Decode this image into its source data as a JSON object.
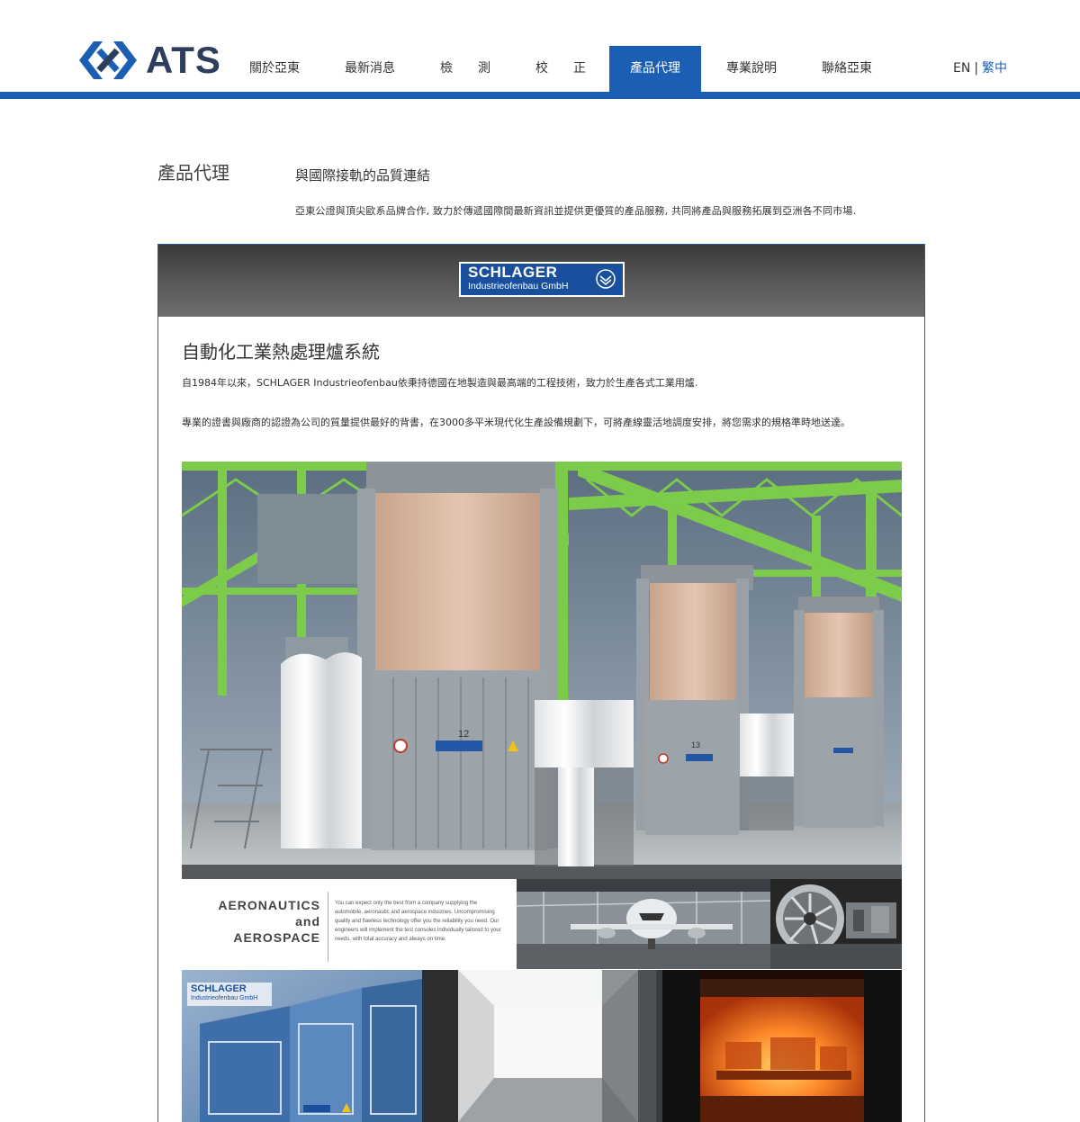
{
  "header": {
    "logo_text": "ATS",
    "nav": [
      {
        "label": "關於亞東"
      },
      {
        "label": "最新消息"
      },
      {
        "label": "檢　　測"
      },
      {
        "label": "校　　正"
      },
      {
        "label": "產品代理"
      },
      {
        "label": "專業說明"
      },
      {
        "label": "聯絡亞東"
      }
    ],
    "lang_en": "EN",
    "lang_sep": "|",
    "lang_current": "繁中"
  },
  "intro": {
    "page_title": "產品代理",
    "subtitle": "與國際接軌的品質連結",
    "text": "亞東公證與頂尖歐系品牌合作, 致力於傳遞國際間最新資訊並提供更優質的產品服務, 共同將產品與服務拓展到亞洲各不同市場."
  },
  "card": {
    "brand_name": "SCHLAGER",
    "brand_sub": "Industrieofenbau GmbH",
    "title": "自動化工業熱處理爐系統",
    "p1": "自1984年以來，SCHLAGER Industrieofenbau依秉持德國在地製造與最高端的工程技術，致力於生產各式工業用爐.",
    "p2": "專業的證書與廠商的認證為公司的質量提供最好的背書，在3000多平米現代化生產設備規劃下，可將產線靈活地調度安排，將您需求的規格準時地送達。"
  },
  "collage": {
    "aero_line1": "AERONAUTICS",
    "aero_line2": "and",
    "aero_line3": "AEROSPACE",
    "aero_body": "You can expect only the best from a company supplying the automobile, aeronautic and aerospace industries. Uncompromising quality and flawless technology offer you the reliability you need. Our engineers will implement the test consoles individually tailored to your needs, with total accuracy and always on time.",
    "mini_brand": "SCHLAGER",
    "mini_sub": "Industrieofenbau GmbH",
    "furnace_num_1": "12",
    "furnace_num_2": "13"
  },
  "colors": {
    "brand_blue": "#1a5fb4",
    "nav_active_bg": "#1a5fb4",
    "frame_green": "#7ccb4a",
    "card_head_gray": "#5c5c5c"
  }
}
